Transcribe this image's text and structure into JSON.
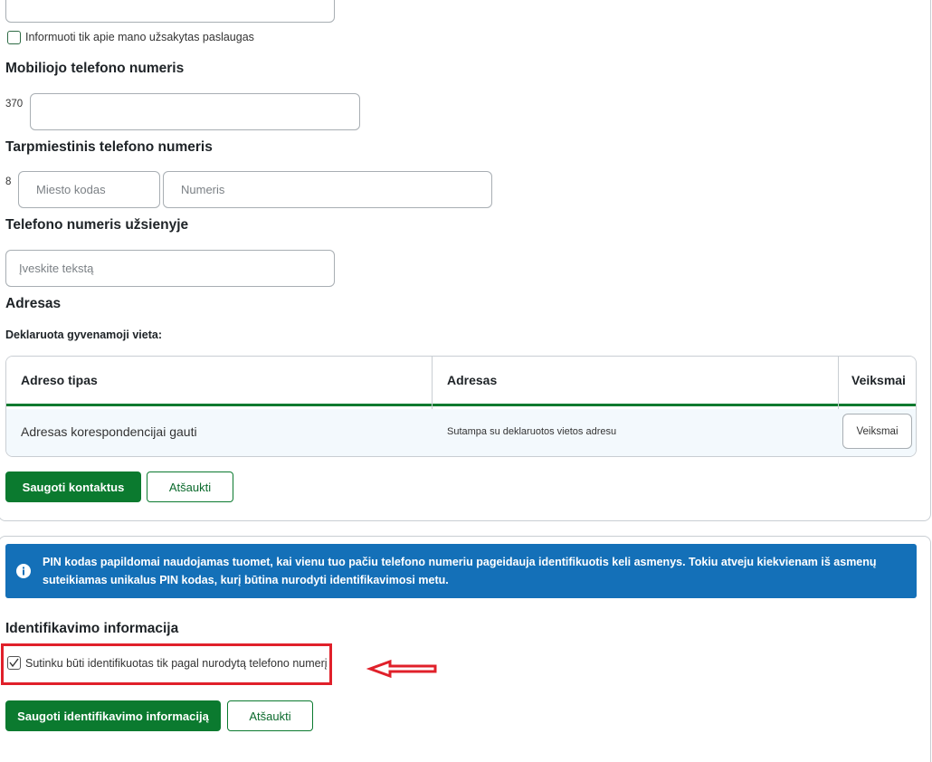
{
  "notify": {
    "checkbox_label": "Informuoti tik apie mano užsakytas paslaugas"
  },
  "mobile": {
    "heading": "Mobiliojo telefono numeris",
    "prefix": "370",
    "value": ""
  },
  "intercity": {
    "heading": "Tarpmiestinis telefono numeris",
    "prefix": "8",
    "city_code_placeholder": "Miesto kodas",
    "number_placeholder": "Numeris"
  },
  "abroad": {
    "heading": "Telefono numeris užsienyje",
    "placeholder": "Įveskite tekstą"
  },
  "address": {
    "heading": "Adresas",
    "declared_label": "Deklaruota gyvenamoji vieta:",
    "declared_value": ""
  },
  "address_table": {
    "columns": [
      "Adreso tipas",
      "Adresas",
      "Veiksmai"
    ],
    "rows": [
      {
        "type": "Adresas korespondencijai gauti",
        "address": "Sutampa su deklaruotos vietos adresu",
        "action": "Veiksmai"
      }
    ]
  },
  "contacts_actions": {
    "save": "Saugoti kontaktus",
    "cancel": "Atšaukti"
  },
  "pin_info": {
    "icon": "info-icon",
    "text": "PIN kodas papildomai naudojamas tuomet, kai vienu tuo pačiu telefono numeriu pageidauja identifikuotis keli asmenys. Tokiu atveju kiekvienam iš asmenų suteikiamas unikalus PIN kodas, kurį būtina nurodyti identifikavimosi metu."
  },
  "identification": {
    "heading": "Identifikavimo informacija",
    "consent_label": "Sutinku būti identifikuotas tik pagal nurodytą telefono numerį",
    "consent_checked": true,
    "save": "Saugoti identifikavimo informaciją",
    "cancel": "Atšaukti"
  },
  "colors": {
    "primary_green": "#0b7a2f",
    "info_blue": "#1470b8",
    "annotation_red": "#e0202a"
  }
}
